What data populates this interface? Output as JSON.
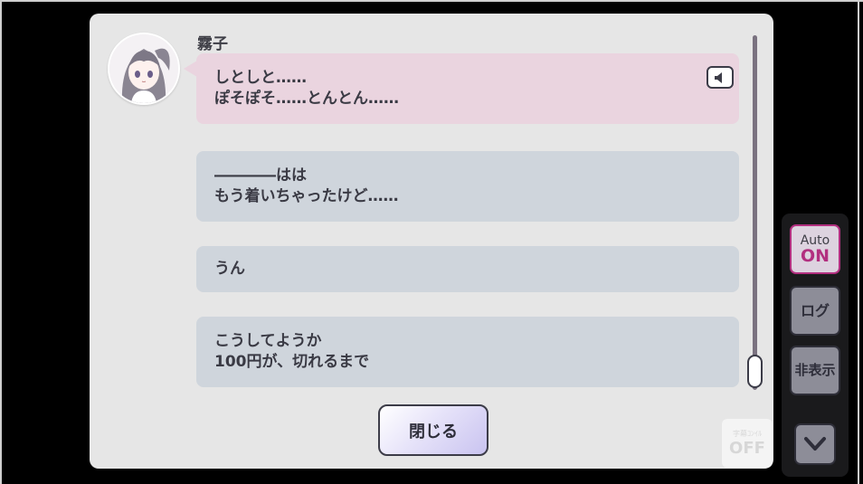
{
  "dialog_log": {
    "speaker": "霧子",
    "entries": [
      {
        "lines": [
          "しとしと……",
          "ぽそぽそ……とんとん……"
        ]
      },
      {
        "lines": [
          "――――はは",
          "もう着いちゃったけど……"
        ]
      },
      {
        "lines": [
          "うん"
        ]
      },
      {
        "lines": [
          "こうしてようか",
          "100円が、切れるまで"
        ]
      }
    ],
    "close_label": "閉じる"
  },
  "side_menu": {
    "auto_label": "Auto",
    "auto_state": "ON",
    "log_label": "ログ",
    "hide_label": "非表示"
  },
  "mute_overlay": {
    "label": "字幕ｺﾝｲﾙ",
    "state": "OFF"
  },
  "icons": [
    "speaker-icon",
    "chevron-down-icon"
  ],
  "colors": {
    "current_bubble": "#ead4df",
    "past_bubble": "#cfd5dc",
    "auto_accent": "#b22f7f"
  }
}
